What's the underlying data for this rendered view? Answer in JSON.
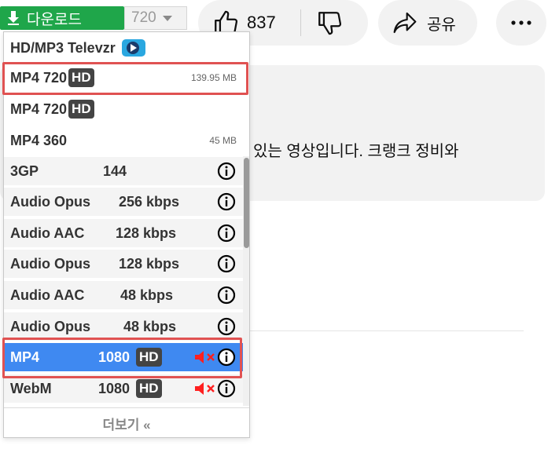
{
  "toolbar": {
    "download_label": "다운로드",
    "quality_value": "720",
    "like_count": "837",
    "share_label": "공유"
  },
  "description": {
    "text_fragment": "있는 영상입니다. 크랭크 정비와"
  },
  "dropdown": {
    "header": "HD/MP3 Televzr",
    "items": [
      {
        "format": "MP4 720",
        "hd": "HD",
        "size": "139.95 MB"
      },
      {
        "format": "MP4 720",
        "hd": "HD",
        "size": ""
      },
      {
        "format": "MP4 360",
        "hd": "",
        "size": "45 MB"
      },
      {
        "format": "3GP",
        "quality": "144"
      },
      {
        "format": "Audio Opus",
        "quality": "256 kbps"
      },
      {
        "format": "Audio AAC",
        "quality": "128 kbps"
      },
      {
        "format": "Audio Opus",
        "quality": "128 kbps"
      },
      {
        "format": "Audio AAC",
        "quality": "48 kbps"
      },
      {
        "format": "Audio Opus",
        "quality": "48 kbps"
      },
      {
        "format": "MP4",
        "quality": "1080",
        "hd": "HD"
      },
      {
        "format": "WebM",
        "quality": "1080",
        "hd": "HD"
      }
    ],
    "more_label": "더보기 «"
  },
  "colors": {
    "download_green": "#1fa64a",
    "selected_blue": "#3f89f1",
    "highlight_red": "#e05252"
  }
}
